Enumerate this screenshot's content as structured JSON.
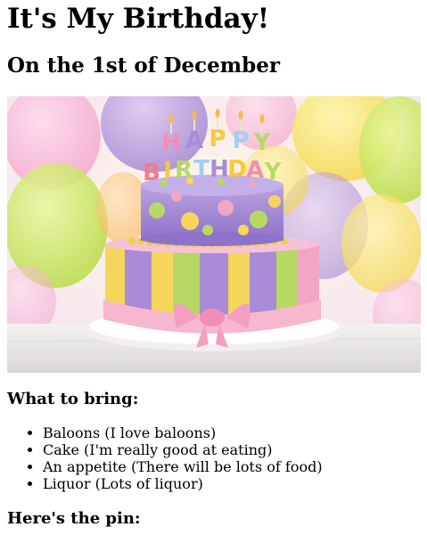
{
  "page": {
    "title": "It's My Birthday!",
    "subtitle": "On the 1st of December"
  },
  "image": {
    "description": "cake-photo",
    "cake_topper_text": "HAPPY BIRTHDAY"
  },
  "bring": {
    "heading": "What to bring:",
    "items": [
      "Baloons (I love baloons)",
      "Cake (I'm really good at eating)",
      "An appetite (There will be lots of food)",
      "Liquor (Lots of liquor)"
    ]
  },
  "pin": {
    "heading": "Here's the pin:"
  }
}
